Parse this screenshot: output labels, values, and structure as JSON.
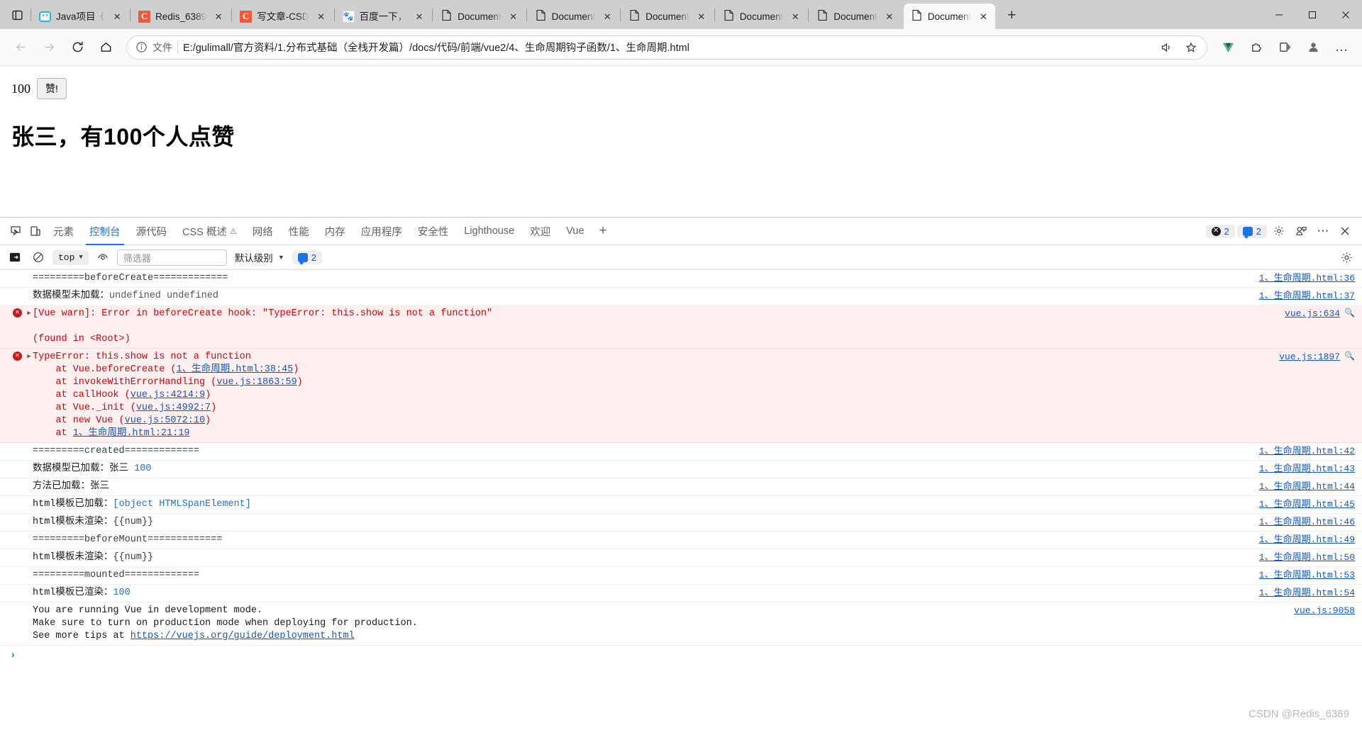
{
  "window": {
    "controls": [
      "minimize",
      "maximize",
      "close"
    ]
  },
  "tabstrip": {
    "tab_search_label": "tab-actions",
    "new_tab_label": "+",
    "close_glyph": "✕",
    "tabs": [
      {
        "title": "Java项目《",
        "favicon": "bilibili-icon",
        "active": false
      },
      {
        "title": "Redis_6389",
        "favicon": "csdn-icon",
        "active": false
      },
      {
        "title": "写文章-CSD",
        "favicon": "csdn-icon",
        "active": false
      },
      {
        "title": "百度一下，",
        "favicon": "baidu-icon",
        "active": false
      },
      {
        "title": "Document",
        "favicon": "document-icon",
        "active": false
      },
      {
        "title": "Document",
        "favicon": "document-icon",
        "active": false
      },
      {
        "title": "Document",
        "favicon": "document-icon",
        "active": false
      },
      {
        "title": "Document",
        "favicon": "document-icon",
        "active": false
      },
      {
        "title": "Document",
        "favicon": "document-icon",
        "active": false
      },
      {
        "title": "Document",
        "favicon": "document-icon",
        "active": true
      }
    ]
  },
  "navbar": {
    "back": "←",
    "forward": "→",
    "reload": "↻",
    "home": "⌂",
    "scheme_label": "文件",
    "url": "E:/gulimall/官方资料/1.分布式基础（全栈开发篇）/docs/代码/前端/vue2/4、生命周期钩子函数/1、生命周期.html",
    "read_aloud": "read-aloud-icon",
    "favorite": "star-icon",
    "vue_devtools": "vue-extension-icon",
    "extensions": "extensions-icon",
    "collections": "collections-icon",
    "profile": "profile-icon",
    "more": "…"
  },
  "page": {
    "like_count": "100",
    "like_button": "赞!",
    "headline": "张三，有100个人点赞"
  },
  "devtools": {
    "tabs": [
      {
        "label": "元素",
        "active": false
      },
      {
        "label": "控制台",
        "active": true
      },
      {
        "label": "源代码",
        "active": false
      },
      {
        "label": "CSS 概述",
        "active": false,
        "warn": "⚠"
      },
      {
        "label": "网络",
        "active": false
      },
      {
        "label": "性能",
        "active": false
      },
      {
        "label": "内存",
        "active": false
      },
      {
        "label": "应用程序",
        "active": false
      },
      {
        "label": "安全性",
        "active": false
      },
      {
        "label": "Lighthouse",
        "active": false
      },
      {
        "label": "欢迎",
        "active": false
      },
      {
        "label": "Vue",
        "active": false
      }
    ],
    "add_tab": "+",
    "error_badge_count": "2",
    "info_badge_count": "2",
    "toolbar": {
      "context": "top",
      "filter_placeholder": "筛选器",
      "filter_value": "",
      "level": "默认级别",
      "message_count": "2"
    },
    "prompt_chevron": "›",
    "logs": [
      {
        "id": "before-create-banner",
        "type": "log",
        "parts": [
          {
            "text": "=========beforeCreate=============",
            "cls": "tok-gray"
          }
        ],
        "source": "1、生命周期.html:36"
      },
      {
        "id": "data-not-loaded",
        "type": "log",
        "parts": [
          {
            "text": "数据模型未加载：",
            "cls": ""
          },
          {
            "text": "undefined undefined",
            "cls": "tok-undef"
          }
        ],
        "source": "1、生命周期.html:37"
      },
      {
        "id": "vue-warn",
        "type": "error",
        "expandable": true,
        "parts": [
          {
            "text": "[Vue warn]: Error in beforeCreate hook: \"TypeError: this.show is not a function\"\n\n(found in <Root>)",
            "cls": ""
          }
        ],
        "source": "vue.js:634",
        "magnify": true
      },
      {
        "id": "type-error",
        "type": "error",
        "expandable": true,
        "parts": [
          {
            "text": "TypeError: this.show is not a function\n    at Vue.beforeCreate (",
            "cls": ""
          },
          {
            "text": "1、生命周期.html:38:45",
            "cls": "stack-link"
          },
          {
            "text": ")\n    at invokeWithErrorHandling (",
            "cls": ""
          },
          {
            "text": "vue.js:1863:59",
            "cls": "stack-link"
          },
          {
            "text": ")\n    at callHook (",
            "cls": ""
          },
          {
            "text": "vue.js:4214:9",
            "cls": "stack-link"
          },
          {
            "text": ")\n    at Vue._init (",
            "cls": ""
          },
          {
            "text": "vue.js:4992:7",
            "cls": "stack-link"
          },
          {
            "text": ")\n    at new Vue (",
            "cls": ""
          },
          {
            "text": "vue.js:5072:10",
            "cls": "stack-link"
          },
          {
            "text": ")\n    at ",
            "cls": ""
          },
          {
            "text": "1、生命周期.html:21:19",
            "cls": "stack-link"
          }
        ],
        "source": "vue.js:1897",
        "magnify": true
      },
      {
        "id": "created-banner",
        "type": "log",
        "parts": [
          {
            "text": "=========created=============",
            "cls": "tok-gray"
          }
        ],
        "source": "1、生命周期.html:42"
      },
      {
        "id": "data-loaded",
        "type": "log",
        "parts": [
          {
            "text": "数据模型已加载：张三 ",
            "cls": ""
          },
          {
            "text": "100",
            "cls": "tok-num"
          }
        ],
        "source": "1、生命周期.html:43"
      },
      {
        "id": "methods-loaded",
        "type": "log",
        "parts": [
          {
            "text": "方法已加载：张三",
            "cls": ""
          }
        ],
        "source": "1、生命周期.html:44"
      },
      {
        "id": "html-template-loaded",
        "type": "log",
        "parts": [
          {
            "text": "html模板已加载：",
            "cls": ""
          },
          {
            "text": "[object HTMLSpanElement]",
            "cls": "tok-obj"
          }
        ],
        "source": "1、生命周期.html:45"
      },
      {
        "id": "html-template-unrendered-1",
        "type": "log",
        "parts": [
          {
            "text": "html模板未渲染：",
            "cls": ""
          },
          {
            "text": "{{num}}",
            "cls": "tok-gray"
          }
        ],
        "source": "1、生命周期.html:46"
      },
      {
        "id": "before-mount-banner",
        "type": "log",
        "parts": [
          {
            "text": "=========beforeMount=============",
            "cls": "tok-gray"
          }
        ],
        "source": "1、生命周期.html:49"
      },
      {
        "id": "html-template-unrendered-2",
        "type": "log",
        "parts": [
          {
            "text": "html模板未渲染：",
            "cls": ""
          },
          {
            "text": "{{num}}",
            "cls": "tok-gray"
          }
        ],
        "source": "1、生命周期.html:50"
      },
      {
        "id": "mounted-banner",
        "type": "log",
        "parts": [
          {
            "text": "=========mounted=============",
            "cls": "tok-gray"
          }
        ],
        "source": "1、生命周期.html:53"
      },
      {
        "id": "html-template-rendered",
        "type": "log",
        "parts": [
          {
            "text": "html模板已渲染：",
            "cls": ""
          },
          {
            "text": "100",
            "cls": "tok-num"
          }
        ],
        "source": "1、生命周期.html:54"
      },
      {
        "id": "vue-dev-mode-tip",
        "type": "log",
        "parts": [
          {
            "text": "You are running Vue in development mode.\nMake sure to turn on production mode when deploying for production.\nSee more tips at ",
            "cls": ""
          },
          {
            "text": "https://vuejs.org/guide/deployment.html",
            "cls": "stack-link"
          }
        ],
        "source": "vue.js:9058"
      }
    ]
  },
  "watermark": "CSDN @Redis_6389",
  "colors": {
    "accent": "#1a73e8",
    "error": "#d8000c",
    "error_bg": "#fff0f0",
    "link": "#1155cc",
    "tabstrip_bg": "#cfcfcf"
  }
}
